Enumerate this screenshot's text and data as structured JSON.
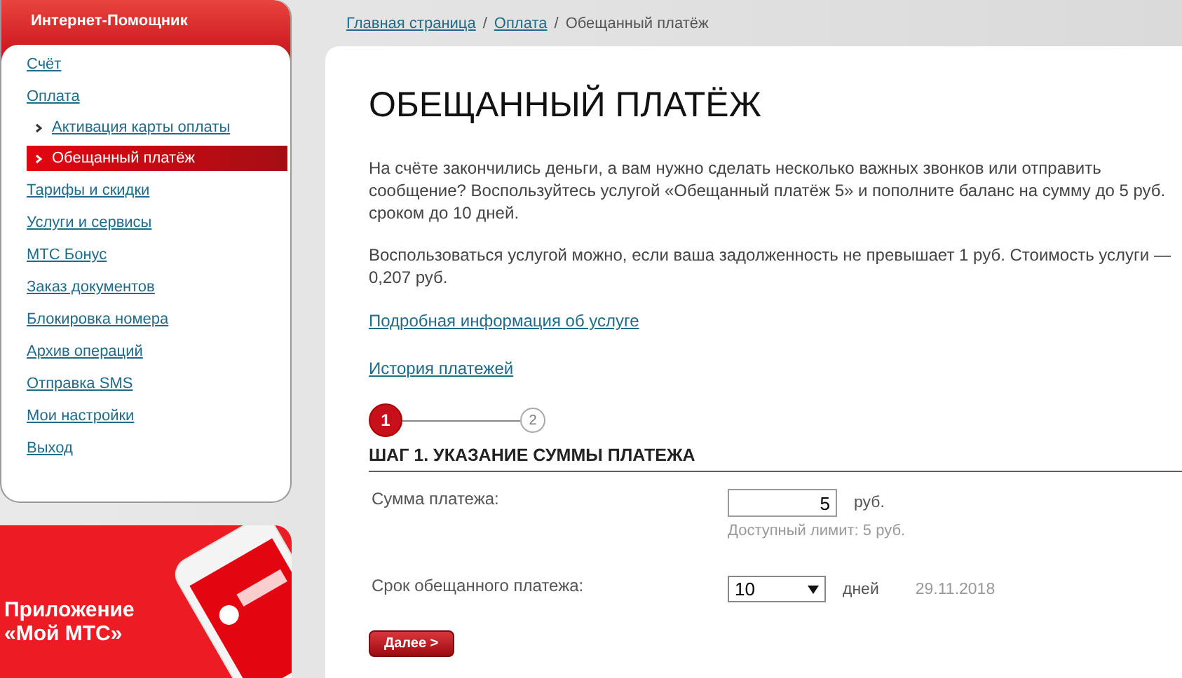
{
  "sidebar": {
    "title": "Интернет-Помощник",
    "items": [
      {
        "label": "Счёт",
        "selected": false
      },
      {
        "label": "Оплата",
        "selected": false,
        "children": [
          {
            "label": "Активация карты оплаты",
            "selected": false
          },
          {
            "label": "Обещанный платёж",
            "selected": true
          }
        ]
      },
      {
        "label": "Тарифы и скидки",
        "selected": false
      },
      {
        "label": "Услуги и сервисы",
        "selected": false
      },
      {
        "label": "МТС Бонус",
        "selected": false
      },
      {
        "label": "Заказ документов",
        "selected": false
      },
      {
        "label": "Блокировка номера",
        "selected": false
      },
      {
        "label": "Архив операций",
        "selected": false
      },
      {
        "label": "Отправка SMS",
        "selected": false
      },
      {
        "label": "Мои настройки",
        "selected": false
      },
      {
        "label": "Выход",
        "selected": false
      }
    ],
    "banner": {
      "lines": [
        "Приложение",
        "«Мой МТС»"
      ]
    }
  },
  "breadcrumb_separator": "/",
  "breadcrumbs": [
    {
      "label": "Главная страница",
      "link": true
    },
    {
      "label": "Оплата",
      "link": true
    },
    {
      "label": "Обещанный платёж",
      "link": false
    }
  ],
  "page": {
    "title": "ОБЕЩАННЫЙ ПЛАТЁЖ",
    "paragraphs": [
      "На счёте закончились деньги, а вам нужно сделать несколько важных звонков или отправить сообщение? Воспользуйтесь услугой «Обещанный платёж 5» и пополните баланс на сумму до 5 руб. сроком до 10 дней.",
      "Воспользоваться услугой можно, если ваша задолженность не превышает 1 руб. Стоимость услуги — 0,207 руб."
    ],
    "links": [
      "Подробная информация об услуге",
      "История платежей"
    ],
    "steps": [
      {
        "label": "1",
        "selected": true
      },
      {
        "label": "2",
        "selected": false
      }
    ],
    "step_title": "ШАГ 1. УКАЗАНИЕ СУММЫ ПЛАТЕЖА",
    "amount": {
      "label": "Сумма платежа:",
      "value": "5",
      "unit": "руб.",
      "hint": "Доступный лимит: 5 руб."
    },
    "term": {
      "label": "Срок обещанного платежа:",
      "value": "10",
      "unit": "дней",
      "date": "29.11.2018"
    },
    "next_button": "Далее >"
  }
}
